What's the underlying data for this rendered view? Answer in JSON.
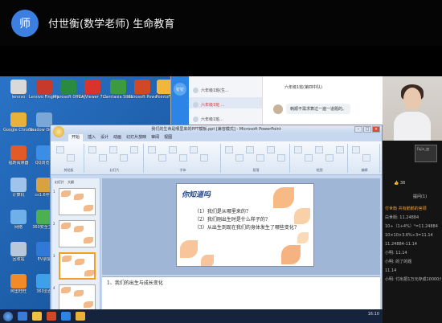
{
  "header": {
    "avatar_text": "师",
    "host_name": "付世衡(数学老师) 生命教育"
  },
  "desktop_icons": [
    {
      "label": "lenovo",
      "color": "#d9d9d9"
    },
    {
      "label": "Lenovo Fingerpri...",
      "color": "#c53a2a"
    },
    {
      "label": "Microsoft Office Ex...",
      "color": "#2a8a3e"
    },
    {
      "label": "CAJViewer 7.2",
      "color": "#d8342c"
    },
    {
      "label": "Camtasia Studio 9",
      "color": "#3d9a3e"
    },
    {
      "label": "Microsoft PowerPoint",
      "color": "#d24726"
    },
    {
      "label": "PointoFix",
      "color": "#f2b63a"
    },
    {
      "label": "Google Chrome",
      "color": "#e8b13a"
    },
    {
      "label": "Shadow Defender",
      "color": "#7aa7d6"
    },
    {
      "label": "福昕阅读器",
      "color": "#e05a2a"
    },
    {
      "label": "QQ浏览器",
      "color": "#3a8ee6"
    },
    {
      "label": "计算机",
      "color": "#9fc3ea"
    },
    {
      "label": "cs1.6中文",
      "color": "#d9a142"
    },
    {
      "label": "网络",
      "color": "#6fb0ea"
    },
    {
      "label": "360安全卫士",
      "color": "#4caf50"
    },
    {
      "label": "回收站",
      "color": "#b8c8d8"
    },
    {
      "label": "EV录屏",
      "color": "#3079d8"
    },
    {
      "label": "阿里旺旺",
      "color": "#f08a2a"
    },
    {
      "label": "360云盘",
      "color": "#3ea0e8"
    }
  ],
  "chat": {
    "side_label": "钉钉",
    "list": [
      {
        "label": "六年级1班(生...",
        "active": false
      },
      {
        "label": "六年级1班 ...",
        "active": true
      },
      {
        "label": "六年级1班...",
        "active": false
      },
      {
        "label": "六年级1班...",
        "active": false
      }
    ],
    "conversation_title": "六年级1班(第四中队)",
    "message": "韩顺不需求算过一遍一道题的。"
  },
  "ppt": {
    "window_title": "我们的生命是哪里来的PPT模板.ppt [兼容模式] - Microsoft PowerPoint",
    "tabs": [
      "开始",
      "插入",
      "设计",
      "动画",
      "幻灯片放映",
      "审阅",
      "视图"
    ],
    "ribbon_groups": [
      "剪贴板",
      "幻灯片",
      "字体",
      "段落",
      "绘图",
      "编辑"
    ],
    "pane_tabs": [
      "幻灯片",
      "大纲"
    ],
    "slide_heading": "你知道吗",
    "slide_lines": [
      "（1）我们是从哪里来的?",
      "（2）我们刚出生时是什么样子的?",
      "（3）从出生到现在我们的身体发生了哪些变化?"
    ],
    "notes_text": "1、我们的出生与成长变化",
    "status": "幻灯片 3/18    \"www.1ppt.com\"    中文(中国)"
  },
  "sidebar": {
    "thumb_label": "Fajin_加",
    "likes": "38",
    "ask": "提问(1)",
    "lines": [
      {
        "text": "付世衡  共有鹅鹅的宫颈",
        "orange": true
      },
      {
        "text": "白世街: 11.24884",
        "orange": false
      },
      {
        "text": "10÷（1+4%）²=11.24884",
        "orange": false
      },
      {
        "text": "10×10×3.6%÷3=11.14",
        "orange": false
      },
      {
        "text": "11.24884-11.14",
        "orange": false
      },
      {
        "text": "小明: 11.14",
        "orange": false
      },
      {
        "text": "小明: 的了的题",
        "orange": false
      },
      {
        "text": "11.14",
        "orange": false
      },
      {
        "text": "小明: 付出把1万元存成10000元",
        "orange": false
      }
    ]
  },
  "taskbar": {
    "clock": "16:10"
  }
}
